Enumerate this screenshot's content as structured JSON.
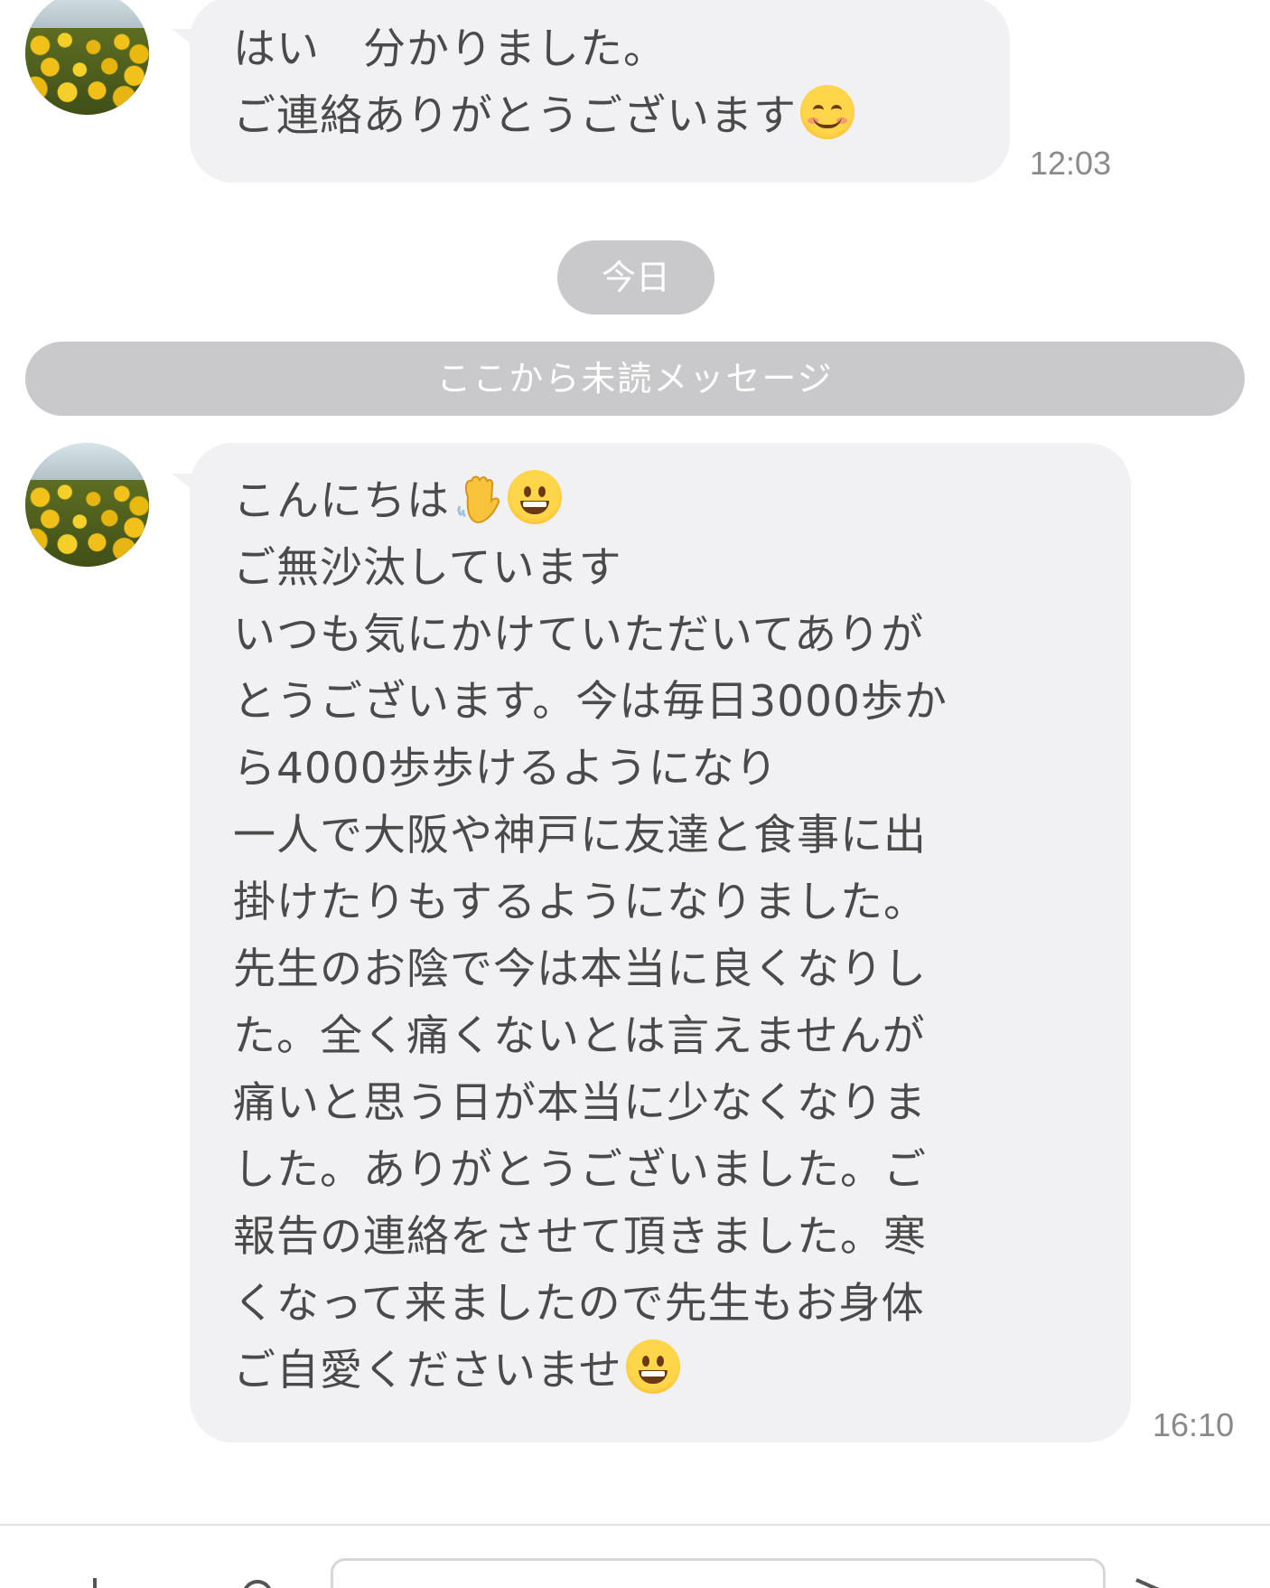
{
  "messages": [
    {
      "lines": [
        "はい　分かりました。",
        "ご連絡ありがとうございます"
      ],
      "trailing_emoji": "smiling-face-icon",
      "time": "12:03"
    },
    {
      "lines": [
        "こんにちは",
        "ご無沙汰しています",
        "いつも気にかけていただいてありが",
        "とうございます。今は毎日3000歩か",
        "ら4000歩歩けるようになり",
        "一人で大阪や神戸に友達と食事に出",
        "掛けたりもするようになりました。",
        "先生のお陰で今は本当に良くなりし",
        "た。全く痛くないとは言えませんが",
        "痛いと思う日が本当に少なくなりま",
        "した。ありがとうございました。ご",
        "報告の連絡をさせて頂きました。寒",
        "くなって来ましたので先生もお身体",
        "ご自愛くださいませ"
      ],
      "time": "16:10"
    }
  ],
  "date_separator": "今日",
  "unread_separator": "ここから未読メッセージ",
  "colors": {
    "bubble": "#f1f1f3",
    "separator": "#c9c9cb",
    "text": "#4a4a4a",
    "time": "#8a8a8a"
  }
}
